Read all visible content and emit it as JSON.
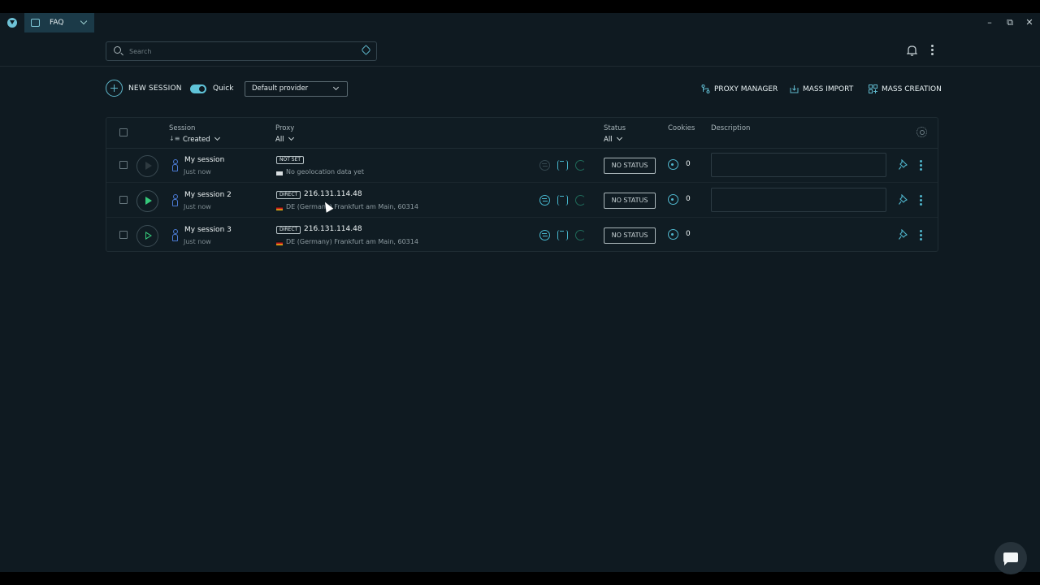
{
  "workspace_tab": {
    "label": "FAQ"
  },
  "search": {
    "placeholder": "Search"
  },
  "toolbar": {
    "new_session_label": "NEW SESSION",
    "quick_label": "Quick",
    "quick_enabled": true,
    "provider_selected": "Default provider",
    "proxy_manager_label": "PROXY MANAGER",
    "mass_import_label": "MASS IMPORT",
    "mass_creation_label": "MASS CREATION"
  },
  "table": {
    "headers": {
      "session": "Session",
      "session_sort": "Created",
      "proxy": "Proxy",
      "proxy_filter": "All",
      "status": "Status",
      "status_filter": "All",
      "cookies": "Cookies",
      "description": "Description"
    },
    "rows": [
      {
        "name": "My session",
        "time": "Just now",
        "proxy_type": "NOT SET",
        "proxy_ip": "",
        "proxy_location": "No geolocation data yet",
        "flag": "none",
        "status": "NO STATUS",
        "cookies": "0",
        "play_state": "disabled"
      },
      {
        "name": "My session 2",
        "time": "Just now",
        "proxy_type": "DIRECT",
        "proxy_ip": "216.131.114.48",
        "proxy_location": "DE (Germany) Frankfurt am Main, 60314",
        "flag": "de",
        "status": "NO STATUS",
        "cookies": "0",
        "play_state": "active"
      },
      {
        "name": "My session 3",
        "time": "Just now",
        "proxy_type": "DIRECT",
        "proxy_ip": "216.131.114.48",
        "proxy_location": "DE (Germany) Frankfurt am Main, 60314",
        "flag": "de",
        "status": "NO STATUS",
        "cookies": "0",
        "play_state": "outline"
      }
    ]
  },
  "colors": {
    "background": "#0f1a21",
    "accent": "#5fb8cc",
    "play_green": "#35c87a"
  }
}
